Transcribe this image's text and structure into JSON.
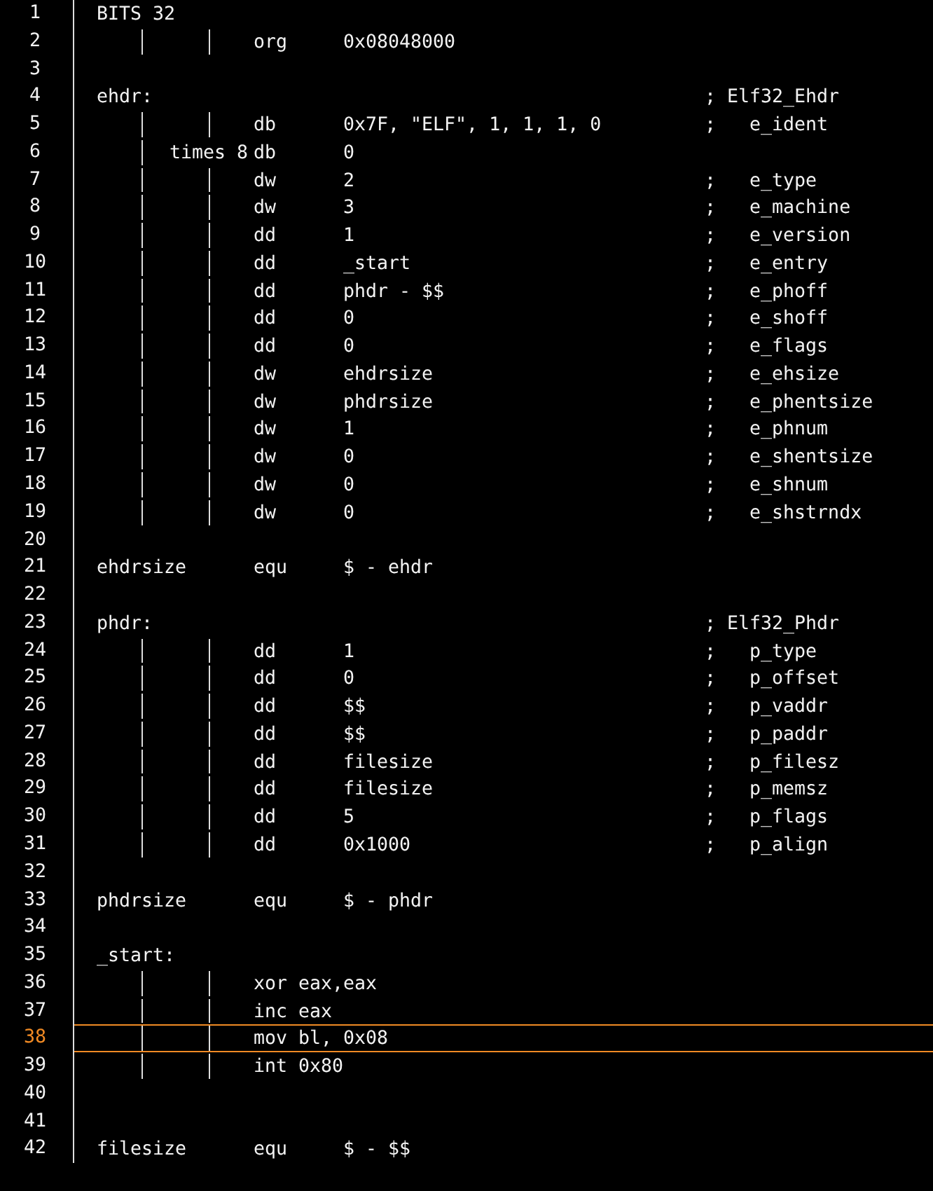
{
  "editor": {
    "lines": [
      {
        "number": "1",
        "label": "BITS 32",
        "current": false
      },
      {
        "number": "2",
        "op": "org",
        "args": "0x08048000",
        "current": false
      },
      {
        "number": "3",
        "current": false
      },
      {
        "number": "4",
        "label": "ehdr:",
        "comment": "; Elf32_Ehdr",
        "current": false
      },
      {
        "number": "5",
        "op": "db",
        "args": "0x7F, \"ELF\", 1, 1, 1, 0",
        "comment": ";   e_ident",
        "current": false
      },
      {
        "number": "6",
        "prefix": "times 8",
        "op": "db",
        "args": "0",
        "current": false
      },
      {
        "number": "7",
        "op": "dw",
        "args": "2",
        "comment": ";   e_type",
        "current": false
      },
      {
        "number": "8",
        "op": "dw",
        "args": "3",
        "comment": ";   e_machine",
        "current": false
      },
      {
        "number": "9",
        "op": "dd",
        "args": "1",
        "comment": ";   e_version",
        "current": false
      },
      {
        "number": "10",
        "op": "dd",
        "args": "_start",
        "comment": ";   e_entry",
        "current": false
      },
      {
        "number": "11",
        "op": "dd",
        "args": "phdr - $$",
        "comment": ";   e_phoff",
        "current": false
      },
      {
        "number": "12",
        "op": "dd",
        "args": "0",
        "comment": ";   e_shoff",
        "current": false
      },
      {
        "number": "13",
        "op": "dd",
        "args": "0",
        "comment": ";   e_flags",
        "current": false
      },
      {
        "number": "14",
        "op": "dw",
        "args": "ehdrsize",
        "comment": ";   e_ehsize",
        "current": false
      },
      {
        "number": "15",
        "op": "dw",
        "args": "phdrsize",
        "comment": ";   e_phentsize",
        "current": false
      },
      {
        "number": "16",
        "op": "dw",
        "args": "1",
        "comment": ";   e_phnum",
        "current": false
      },
      {
        "number": "17",
        "op": "dw",
        "args": "0",
        "comment": ";   e_shentsize",
        "current": false
      },
      {
        "number": "18",
        "op": "dw",
        "args": "0",
        "comment": ";   e_shnum",
        "current": false
      },
      {
        "number": "19",
        "op": "dw",
        "args": "0",
        "comment": ";   e_shstrndx",
        "current": false
      },
      {
        "number": "20",
        "current": false
      },
      {
        "number": "21",
        "label": "ehdrsize",
        "op": "equ",
        "args": "$ - ehdr",
        "current": false
      },
      {
        "number": "22",
        "current": false
      },
      {
        "number": "23",
        "label": "phdr:",
        "comment": "; Elf32_Phdr",
        "current": false
      },
      {
        "number": "24",
        "op": "dd",
        "args": "1",
        "comment": ";   p_type",
        "current": false
      },
      {
        "number": "25",
        "op": "dd",
        "args": "0",
        "comment": ";   p_offset",
        "current": false
      },
      {
        "number": "26",
        "op": "dd",
        "args": "$$",
        "comment": ";   p_vaddr",
        "current": false
      },
      {
        "number": "27",
        "op": "dd",
        "args": "$$",
        "comment": ";   p_paddr",
        "current": false
      },
      {
        "number": "28",
        "op": "dd",
        "args": "filesize",
        "comment": ";   p_filesz",
        "current": false
      },
      {
        "number": "29",
        "op": "dd",
        "args": "filesize",
        "comment": ";   p_memsz",
        "current": false
      },
      {
        "number": "30",
        "op": "dd",
        "args": "5",
        "comment": ";   p_flags",
        "current": false
      },
      {
        "number": "31",
        "op": "dd",
        "args": "0x1000",
        "comment": ";   p_align",
        "current": false
      },
      {
        "number": "32",
        "current": false
      },
      {
        "number": "33",
        "label": "phdrsize",
        "op": "equ",
        "args": "$ - phdr",
        "current": false
      },
      {
        "number": "34",
        "current": false
      },
      {
        "number": "35",
        "label": "_start:",
        "current": false
      },
      {
        "number": "36",
        "stmt": "xor eax,eax",
        "current": false
      },
      {
        "number": "37",
        "stmt": "inc eax",
        "current": false
      },
      {
        "number": "38",
        "stmt": "mov bl, 0x08",
        "current": true
      },
      {
        "number": "39",
        "stmt": "int 0x80",
        "current": false
      },
      {
        "number": "40",
        "current": false
      },
      {
        "number": "41",
        "current": false
      },
      {
        "number": "42",
        "label": "filesize",
        "op": "equ",
        "args": "$ - $$",
        "current": false
      }
    ]
  }
}
